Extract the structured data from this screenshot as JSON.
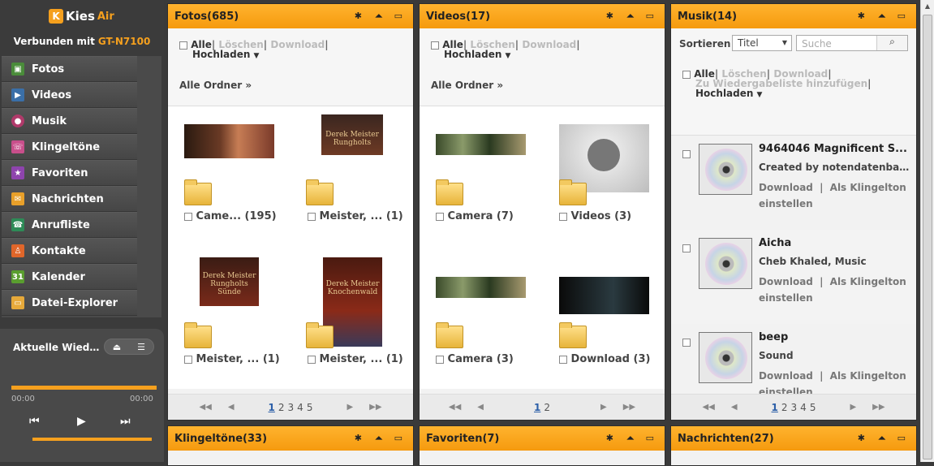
{
  "app": {
    "logo_mark": "K",
    "logo_name": "Kies",
    "logo_air": "Air",
    "connected_label": "Verbunden mit",
    "device": "GT-N7100"
  },
  "nav": {
    "items": [
      {
        "label": "Fotos",
        "icon": "photo-icon",
        "color": "#4a8c3a"
      },
      {
        "label": "Videos",
        "icon": "video-icon",
        "color": "#3a6fa8"
      },
      {
        "label": "Musik",
        "icon": "music-icon",
        "color": "#b03a6a"
      },
      {
        "label": "Klingeltöne",
        "icon": "ringtone-icon",
        "color": "#c84f8b"
      },
      {
        "label": "Favoriten",
        "icon": "star-icon",
        "color": "#8e44ad"
      },
      {
        "label": "Nachrichten",
        "icon": "envelope-icon",
        "color": "#e8a02a"
      },
      {
        "label": "Anrufliste",
        "icon": "phone-icon",
        "color": "#2e8b57"
      },
      {
        "label": "Kontakte",
        "icon": "contact-icon",
        "color": "#e0662a"
      },
      {
        "label": "Kalender",
        "icon": "calendar-icon",
        "color": "#5a9e2f"
      },
      {
        "label": "Datei-Explorer",
        "icon": "folder-icon",
        "color": "#e6a93a"
      }
    ]
  },
  "player": {
    "title": "Aktuelle Wiedergabeliste",
    "time_start": "00:00",
    "time_end": "00:00",
    "progress": 1.0,
    "volume": 1.0
  },
  "actions": {
    "all": "Alle",
    "delete": "Löschen",
    "download": "Download",
    "upload": "Hochladen",
    "all_folders": "Alle Ordner »",
    "add_playlist": "Zu Wiedergabeliste hinzufügen"
  },
  "fotos": {
    "title": "Fotos(685)",
    "items": [
      {
        "label": "Came... (195)"
      },
      {
        "label": "Meister, ... (1)"
      },
      {
        "label": "Meister, ... (1)"
      },
      {
        "label": "Meister, ... (1)"
      }
    ],
    "pages": [
      "1",
      "2",
      "3",
      "4",
      "5"
    ]
  },
  "videos": {
    "title": "Videos(17)",
    "items": [
      {
        "label": "Camera (7)"
      },
      {
        "label": "Videos (3)"
      },
      {
        "label": "Camera (3)"
      },
      {
        "label": "Download (3)"
      }
    ],
    "pages": [
      "1",
      "2"
    ]
  },
  "musik": {
    "title": "Musik(14)",
    "sort_label": "Sortieren",
    "sort_value": "Titel",
    "search_placeholder": "Suche",
    "items": [
      {
        "title": "9464046 Magnificent S...",
        "sub": "Created by notendatenban...",
        "action1": "Download",
        "action2": "Als Klingelton einstellen"
      },
      {
        "title": "Aicha",
        "sub": "Cheb Khaled, Music",
        "action1": "Download",
        "action2": "Als Klingelton einstellen"
      },
      {
        "title": "beep",
        "sub": "Sound",
        "action1": "Download",
        "action2": "Als Klingelton einstellen"
      }
    ],
    "pages": [
      "1",
      "2",
      "3",
      "4",
      "5"
    ]
  },
  "bottom": {
    "klingeltoene": "Klingeltöne(33)",
    "favoriten": "Favoriten(7)",
    "nachrichten": "Nachrichten(27)"
  },
  "book": {
    "author": "Derek Meister",
    "title1": "Rungholts",
    "title2": "Rungholts Sünde",
    "title3": "Knochenwald"
  }
}
